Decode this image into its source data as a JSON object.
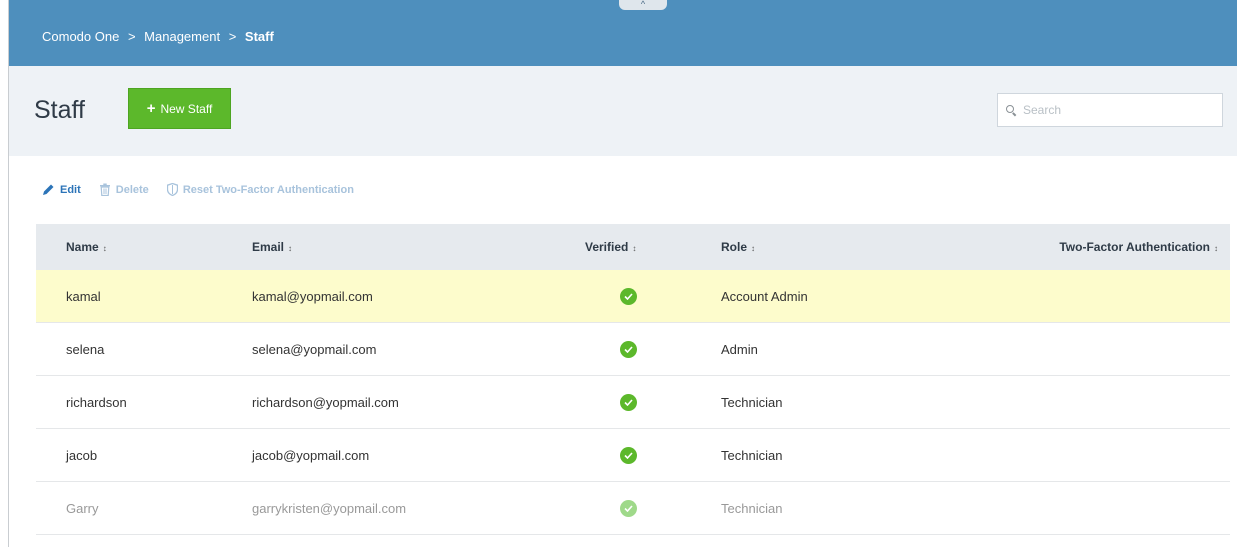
{
  "breadcrumb": {
    "items": [
      "Comodo One",
      "Management",
      "Staff"
    ],
    "separator": ">"
  },
  "collapse_glyph": "^",
  "page": {
    "title": "Staff",
    "new_button_label": "New Staff"
  },
  "search": {
    "placeholder": "Search",
    "value": ""
  },
  "toolbar": {
    "edit_label": "Edit",
    "delete_label": "Delete",
    "reset_label": "Reset Two-Factor Authentication"
  },
  "table": {
    "columns": [
      "Name",
      "Email",
      "Verified",
      "Role",
      "Two-Factor Authentication"
    ],
    "sort_glyph": "↕",
    "rows": [
      {
        "name": "kamal",
        "email": "kamal@yopmail.com",
        "verified": true,
        "role": "Account Admin",
        "tfa": ""
      },
      {
        "name": "selena",
        "email": "selena@yopmail.com",
        "verified": true,
        "role": "Admin",
        "tfa": ""
      },
      {
        "name": "richardson",
        "email": "richardson@yopmail.com",
        "verified": true,
        "role": "Technician",
        "tfa": ""
      },
      {
        "name": "jacob",
        "email": "jacob@yopmail.com",
        "verified": true,
        "role": "Technician",
        "tfa": ""
      },
      {
        "name": "Garry",
        "email": "garrykristen@yopmail.com",
        "verified": true,
        "role": "Technician",
        "tfa": ""
      }
    ]
  },
  "colors": {
    "topbar": "#4e8fbd",
    "header_band": "#eef2f6",
    "primary_button": "#5cb82b",
    "link": "#2c74b8",
    "selected_row": "#fdfccc",
    "verified_check": "#5cb82b"
  },
  "icons": {
    "edit": "pencil-icon",
    "delete": "trash-icon",
    "reset": "shield-icon",
    "search": "search-icon",
    "verified": "check-circle-icon"
  }
}
